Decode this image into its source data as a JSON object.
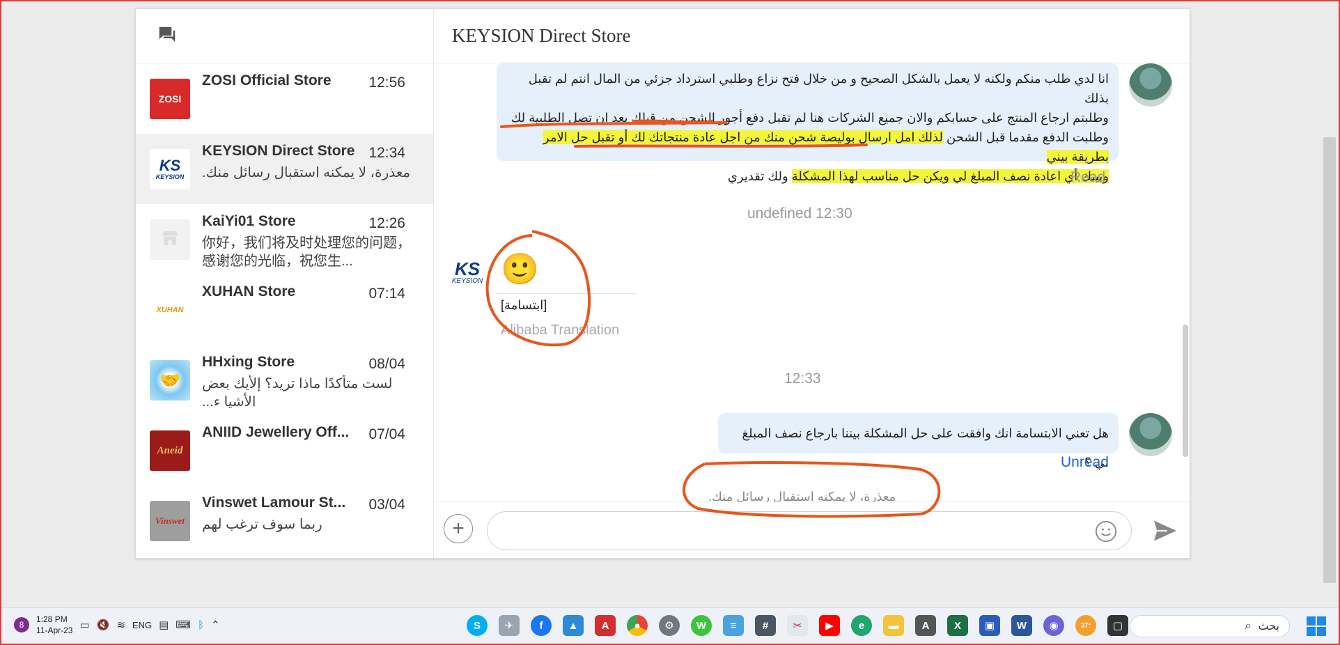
{
  "colors": {
    "accent": "#1e5fd6",
    "annotation": "#e8561d",
    "highlight": "#f2f53a",
    "bubble": "#e6f0fb"
  },
  "sidebar": {
    "header_icon": "chat-bubbles-icon",
    "conversations": [
      {
        "name": "ZOSI Official Store",
        "time": "12:56",
        "preview": "",
        "avatar_text": "ZOSI",
        "avatar_bg": "#d92a2a"
      },
      {
        "name": "KEYSION Direct Store",
        "time": "12:34",
        "preview": "معذرة، لا يمكنه استقبال رسائل منك.",
        "avatar_text": "KS",
        "avatar_bg": "#ffffff",
        "active": true
      },
      {
        "name": "KaiYi01 Store",
        "time": "12:26",
        "preview": "你好，我们将及时处理您的问题，感谢您的光临，祝您生...",
        "avatar_text": "",
        "avatar_bg": "#f2f2f2"
      },
      {
        "name": "XUHAN Store",
        "time": "07:14",
        "preview": "",
        "avatar_text": "XUHAN",
        "avatar_bg": "#ffffff"
      },
      {
        "name": "HHxing Store",
        "time": "08/04",
        "preview": "لست متأكدًا ماذا تريد؟ إلأيك بعض الأشيا ء...",
        "avatar_text": "",
        "avatar_bg": "#bfe3f7"
      },
      {
        "name": "ANIID Jewellery Off...",
        "time": "07/04",
        "preview": "",
        "avatar_text": "Aneid",
        "avatar_bg": "#9b1b1b"
      },
      {
        "name": "Vinswet Lamour St...",
        "time": "03/04",
        "preview": "ربما سوف ترغب لهم",
        "avatar_text": "Vinswet",
        "avatar_bg": "#9e9e9e"
      }
    ]
  },
  "main": {
    "title": "KEYSION Direct Store",
    "messages": {
      "out1": {
        "line1": "انا لدي طلب منكم ولكنه لا يعمل بالشكل الصحيح و من خلال فتح نزاع وطلبي استرداد جزئي من المال انتم لم تقبل بذلك",
        "line2": "وطلبتم ارجاع المنتج على حسابكم والان جميع الشركات هنا لم تقبل دفع أجور الشحن من قبلك بعد ان تصل الطلبية لك",
        "line3_plain": "وطلبت الدفع مقدما قبل الشحن",
        "line3_hl": "لذلك امل ارسال بوليصة شحن منك من اجل عادة منتجاتك لك أو تقبل حل الامر بطريقة بيني",
        "line4_hl": "وبينك أي اعادة نصف المبلغ لي ويكن حل مناسب لهذا المشكلة",
        "line4_plain": "ولك تقديري",
        "status": "Read"
      },
      "ts1": "undefined 12:30",
      "in1": {
        "emoji": "🙂",
        "text": "[ابتسامة]",
        "translation": "Alibaba Translation"
      },
      "ts2": "12:33",
      "out2": {
        "text": "هل تعني الابتسامة انك وافقت على حل المشكلة بيننا بارجاع نصف المبلغ لي ؟",
        "status": "Unread"
      },
      "system": "معذرة، لا يمكنه استقبال رسائل منك."
    },
    "input": {
      "placeholder": ""
    }
  },
  "taskbar": {
    "badge": "8",
    "time": "1:28 PM",
    "date": "11-Apr-23",
    "lang": "ENG",
    "search_placeholder": "بحث",
    "weather": "37°"
  }
}
